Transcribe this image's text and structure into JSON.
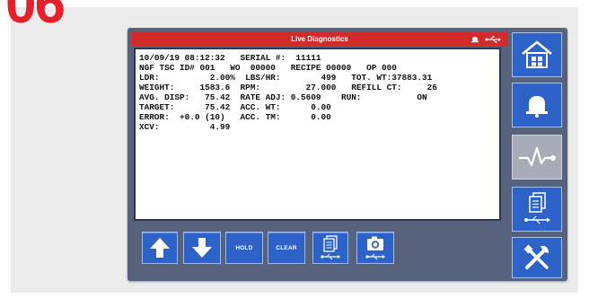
{
  "step_number": "06",
  "window": {
    "title": "Live Diagnostics"
  },
  "status_icons": [
    "alarm-bell-icon",
    "usb-icon"
  ],
  "readout": {
    "lines": [
      "10/09/19 08:12:32   SERIAL #:  11111",
      "NGF TSC ID# 001   WO  00000   RECIPE 00000   OP 000",
      "LDR:          2.00%  LBS/HR:        499   TOT. WT:37883.31",
      "WEIGHT:     1583.6  RPM:         27.000   REFILL CT:     26",
      "AVG. DISP:   75.42  RATE ADJ: 0.5609    RUN:           ON",
      "TARGET:      75.42  ACC. WT:      0.00",
      "ERROR:  +0.0 (10)   ACC. TM:      0.00",
      "XCV:          4.99"
    ]
  },
  "toolbar": {
    "hold_label": "HOLD",
    "clear_label": "CLEAR"
  },
  "sidebar": {
    "items": [
      "home-icon",
      "alarm-bell-icon",
      "diagnostics-pulse-icon",
      "copy-to-usb-icon",
      "tools-icon"
    ],
    "active": "diagnostics-pulse-icon"
  },
  "colors": {
    "title_bar": "#d32a2c",
    "button_blue": "#2d63c8",
    "device_frame": "#57627c",
    "active_button": "#a7acb8",
    "step_number": "#e5202a"
  }
}
